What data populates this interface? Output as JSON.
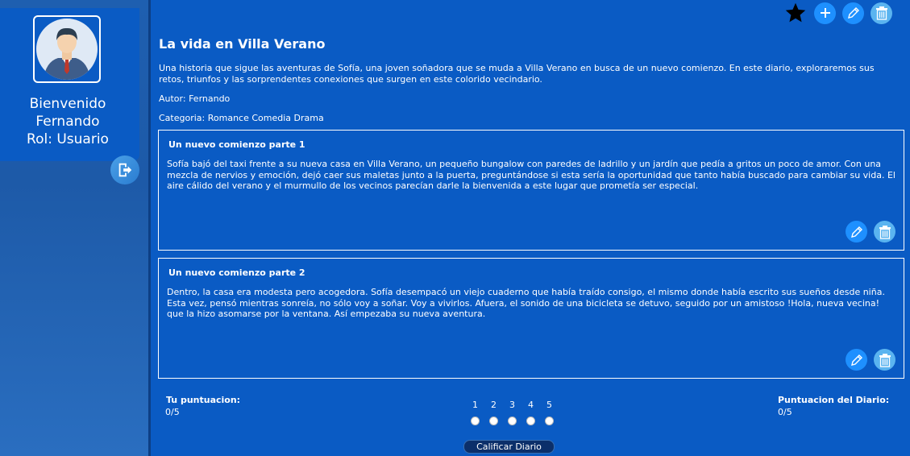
{
  "user": {
    "greeting": "Bienvenido",
    "name": "Fernando",
    "role": "Rol: Usuario"
  },
  "toolbar": {
    "icons": [
      "star-icon",
      "plus-icon",
      "pencil-icon",
      "trash-icon"
    ]
  },
  "diary": {
    "title": "La vida en Villa Verano",
    "description": "Una historia que sigue las aventuras de Sofía, una joven soñadora que se muda a Villa Verano en busca de un nuevo comienzo. En este diario, exploraremos sus retos, triunfos y las sorprendentes conexiones que surgen en este colorido vecindario.",
    "author": "Autor: Fernando",
    "category": "Categoria: Romance Comedia Drama"
  },
  "entries": [
    {
      "title": "Un nuevo comienzo parte 1",
      "body": "Sofía bajó del taxi frente a su nueva casa en Villa Verano, un pequeño bungalow con paredes de ladrillo y un jardín que pedía a gritos un poco de amor. Con una mezcla de nervios y emoción, dejó caer sus maletas junto a la puerta, preguntándose si esta sería la oportunidad que tanto había buscado para cambiar su vida. El aire cálido del verano y el murmullo de los vecinos parecían darle la bienvenida a este lugar que prometía ser especial."
    },
    {
      "title": "Un nuevo comienzo parte 2",
      "body": "Dentro, la casa era modesta pero acogedora. Sofía desempacó un viejo cuaderno que había traído consigo, el mismo donde había escrito sus sueños desde niña. Esta vez, pensó mientras sonreía, no sólo voy a soñar. Voy a vivirlos. Afuera, el sonido de una bicicleta se detuvo, seguido por un amistoso !Hola, nueva vecina! que la hizo asomarse por la ventana. Así empezaba su nueva aventura."
    }
  ],
  "rating": {
    "my_label": "Tu puntuacion:",
    "my_value": "0/5",
    "diary_label": "Puntuacion del Diario:",
    "diary_value": "0/5",
    "options": [
      "1",
      "2",
      "3",
      "4",
      "5"
    ],
    "submit_label": "Calificar Diario"
  },
  "colors": {
    "background": "#0a5bc4",
    "button_blue": "#1e90ff",
    "button_light": "#5ab4f0",
    "submit_bg": "#0b2f6a"
  }
}
